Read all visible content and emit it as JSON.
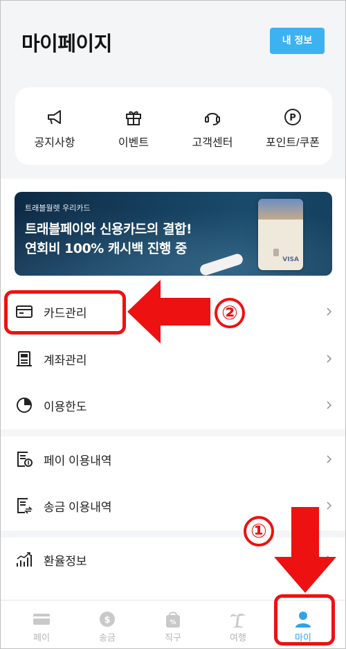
{
  "header": {
    "title": "마이페이지",
    "my_info_label": "내 정보"
  },
  "quick_menu": [
    {
      "label": "공지사항",
      "icon": "megaphone-icon"
    },
    {
      "label": "이벤트",
      "icon": "gift-icon"
    },
    {
      "label": "고객센터",
      "icon": "headset-icon"
    },
    {
      "label": "포인트/쿠폰",
      "icon": "point-icon"
    }
  ],
  "banner": {
    "sub": "트래블월렛 우리카드",
    "line1": "트래블페이와 신용카드의 결합!",
    "line2": "연회비 100% 캐시백 진행 중",
    "card_brand": "VISA"
  },
  "menu_items": [
    {
      "label": "카드관리",
      "icon": "card-icon"
    },
    {
      "label": "계좌관리",
      "icon": "account-icon"
    },
    {
      "label": "이용한도",
      "icon": "pie-chart-icon"
    },
    {
      "label": "페이 이용내역",
      "icon": "pay-history-icon"
    },
    {
      "label": "송금 이용내역",
      "icon": "transfer-history-icon"
    },
    {
      "label": "환율정보",
      "icon": "exchange-chart-icon"
    }
  ],
  "bottom_nav": [
    {
      "label": "페이",
      "icon": "pay-card-icon"
    },
    {
      "label": "송금",
      "icon": "coin-icon"
    },
    {
      "label": "직구",
      "icon": "shopping-bag-icon"
    },
    {
      "label": "여행",
      "icon": "palm-tree-icon"
    },
    {
      "label": "마이",
      "icon": "person-icon",
      "active": true
    }
  ],
  "annotations": {
    "step1": "①",
    "step2": "②",
    "color": "#ee1111"
  },
  "colors": {
    "accent": "#3cb2f2",
    "nav_active": "#2fa3eb",
    "annotation": "#ee1111"
  }
}
